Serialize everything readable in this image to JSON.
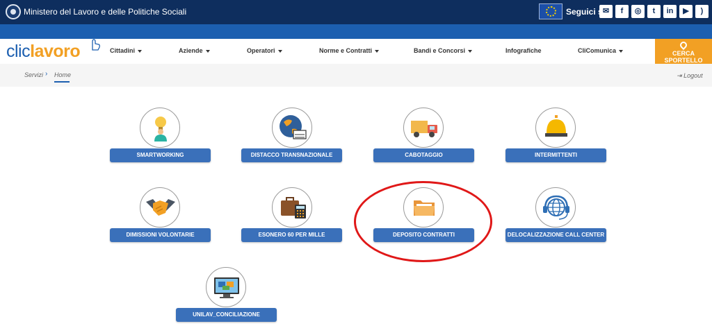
{
  "header": {
    "ministry_name": "Ministero del Lavoro e delle Politiche Sociali",
    "follow_label": "Seguici su:",
    "social_icons": [
      "email-icon",
      "facebook-icon",
      "instagram-icon",
      "twitter-icon",
      "linkedin-icon",
      "youtube-icon",
      "rss-icon"
    ],
    "social_glyphs": {
      "email": "✉",
      "facebook": "f",
      "instagram": "◎",
      "twitter": "t",
      "linkedin": "in",
      "youtube": "▶",
      "rss": ")"
    }
  },
  "brand": {
    "clic": "clic",
    "lavoro": "lavoro"
  },
  "nav": {
    "items": [
      "Cittadini",
      "Aziende",
      "Operatori",
      "Norme e Contratti",
      "Bandi e Concorsi",
      "Infografiche",
      "CliComunica"
    ],
    "cta": "CERCA SPORTELLO"
  },
  "breadcrumb": {
    "servizi": "Servizi",
    "home": "Home",
    "separator": "›",
    "logout": "Logout"
  },
  "services": [
    {
      "label": "SMARTWORKING",
      "icon": "lightbulb-worker-icon"
    },
    {
      "label": "DISTACCO TRANSNAZIONALE",
      "icon": "globe-crane-icon"
    },
    {
      "label": "CABOTAGGIO",
      "icon": "delivery-truck-icon"
    },
    {
      "label": "INTERMITTENTI",
      "icon": "service-bell-icon"
    },
    {
      "label": "DIMISSIONI VOLONTARIE",
      "icon": "handshake-icon"
    },
    {
      "label": "ESONERO 60 PER MILLE",
      "icon": "briefcase-calculator-icon"
    },
    {
      "label": "DEPOSITO CONTRATTI",
      "icon": "folder-icon"
    },
    {
      "label": "DELOCALIZZAZIONE CALL CENTER",
      "icon": "headset-globe-icon"
    },
    {
      "label": "UNILAV_CONCILIAZIONE",
      "icon": "monitor-puzzle-icon"
    }
  ],
  "colors": {
    "top_bar": "#0e2e5e",
    "nav_stripe": "#1c5fb0",
    "accent_orange": "#f2a024",
    "service_button": "#3a70ba",
    "annotation": "#e01818"
  }
}
